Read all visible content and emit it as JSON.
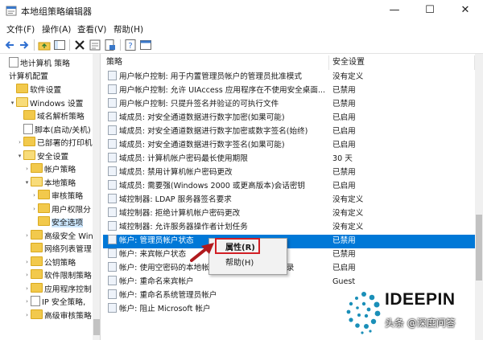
{
  "window": {
    "title": "本地组策略编辑器",
    "controls": [
      "—",
      "☐",
      "✕"
    ]
  },
  "menu": [
    "文件(F)",
    "操作(A)",
    "查看(V)",
    "帮助(H)"
  ],
  "tree": [
    {
      "label": "地计算机 策略",
      "indent": 0,
      "icon": "doc",
      "exp": ""
    },
    {
      "label": "计算机配置",
      "indent": 0,
      "icon": "none",
      "exp": ""
    },
    {
      "label": "软件设置",
      "indent": 1,
      "icon": "folder",
      "exp": ""
    },
    {
      "label": "Windows 设置",
      "indent": 1,
      "icon": "folder-open",
      "exp": "▾"
    },
    {
      "label": "域名解析策略",
      "indent": 2,
      "icon": "folder",
      "exp": ""
    },
    {
      "label": "脚本(启动/关机)",
      "indent": 2,
      "icon": "doc",
      "exp": ""
    },
    {
      "label": "已部署的打印机",
      "indent": 2,
      "icon": "folder",
      "exp": "›"
    },
    {
      "label": "安全设置",
      "indent": 2,
      "icon": "folder-open",
      "exp": "▾"
    },
    {
      "label": "帐户策略",
      "indent": 3,
      "icon": "folder",
      "exp": "›"
    },
    {
      "label": "本地策略",
      "indent": 3,
      "icon": "folder-open",
      "exp": "▾"
    },
    {
      "label": "审核策略",
      "indent": 4,
      "icon": "folder",
      "exp": "›"
    },
    {
      "label": "用户权限分",
      "indent": 4,
      "icon": "folder",
      "exp": "›"
    },
    {
      "label": "安全选项",
      "indent": 4,
      "icon": "folder",
      "exp": "",
      "selected": true
    },
    {
      "label": "高级安全 Win",
      "indent": 3,
      "icon": "folder",
      "exp": "›"
    },
    {
      "label": "网络列表管理",
      "indent": 3,
      "icon": "folder",
      "exp": ""
    },
    {
      "label": "公钥策略",
      "indent": 3,
      "icon": "folder",
      "exp": "›"
    },
    {
      "label": "软件限制策略",
      "indent": 3,
      "icon": "folder",
      "exp": "›"
    },
    {
      "label": "应用程序控制",
      "indent": 3,
      "icon": "folder",
      "exp": "›"
    },
    {
      "label": "IP 安全策略,",
      "indent": 3,
      "icon": "doc",
      "exp": "›"
    },
    {
      "label": "高级审核策略",
      "indent": 3,
      "icon": "folder",
      "exp": "›"
    }
  ],
  "list": {
    "columns": {
      "policy": "策略",
      "setting": "安全设置"
    },
    "rows": [
      {
        "policy": "用户帐户控制: 用于内置管理员帐户的管理员批准模式",
        "setting": "没有定义"
      },
      {
        "policy": "用户帐户控制: 允许 UIAccess 应用程序在不使用安全桌面...",
        "setting": "已禁用"
      },
      {
        "policy": "用户帐户控制: 只提升签名并验证的可执行文件",
        "setting": "已禁用"
      },
      {
        "policy": "域成员: 对安全通道数据进行数字加密(如果可能)",
        "setting": "已启用"
      },
      {
        "policy": "域成员: 对安全通道数据进行数字加密或数字签名(始终)",
        "setting": "已启用"
      },
      {
        "policy": "域成员: 对安全通道数据进行数字签名(如果可能)",
        "setting": "已启用"
      },
      {
        "policy": "域成员: 计算机帐户密码最长使用期限",
        "setting": "30 天"
      },
      {
        "policy": "域成员: 禁用计算机帐户密码更改",
        "setting": "已禁用"
      },
      {
        "policy": "域成员: 需要强(Windows 2000 或更高版本)会话密钥",
        "setting": "已启用"
      },
      {
        "policy": "域控制器: LDAP 服务器签名要求",
        "setting": "没有定义"
      },
      {
        "policy": "域控制器: 拒绝计算机帐户密码更改",
        "setting": "没有定义"
      },
      {
        "policy": "域控制器: 允许服务器操作者计划任务",
        "setting": "没有定义"
      },
      {
        "policy": "帐户: 管理员帐户状态",
        "setting": "已禁用",
        "selected": true
      },
      {
        "policy": "帐户: 来宾帐户状态",
        "setting": "已禁用"
      },
      {
        "policy": "帐户: 使用空密码的本地帐户只允许进行控制台登录",
        "setting": "已启用"
      },
      {
        "policy": "帐户: 重命名来宾帐户",
        "setting": "Guest"
      },
      {
        "policy": "帐户: 重命名系统管理员帐户",
        "setting": ""
      },
      {
        "policy": "帐户: 阻止 Microsoft 帐户",
        "setting": ""
      }
    ]
  },
  "context_menu": {
    "items": [
      "属性(R)",
      "帮助(H)"
    ]
  },
  "branding": {
    "logo_text": "IDEEPIN",
    "watermark": "头条 @深度问答"
  },
  "colors": {
    "selection": "#0078d7",
    "highlight_box": "#d21f25",
    "tree_selected": "#cde8ff"
  }
}
